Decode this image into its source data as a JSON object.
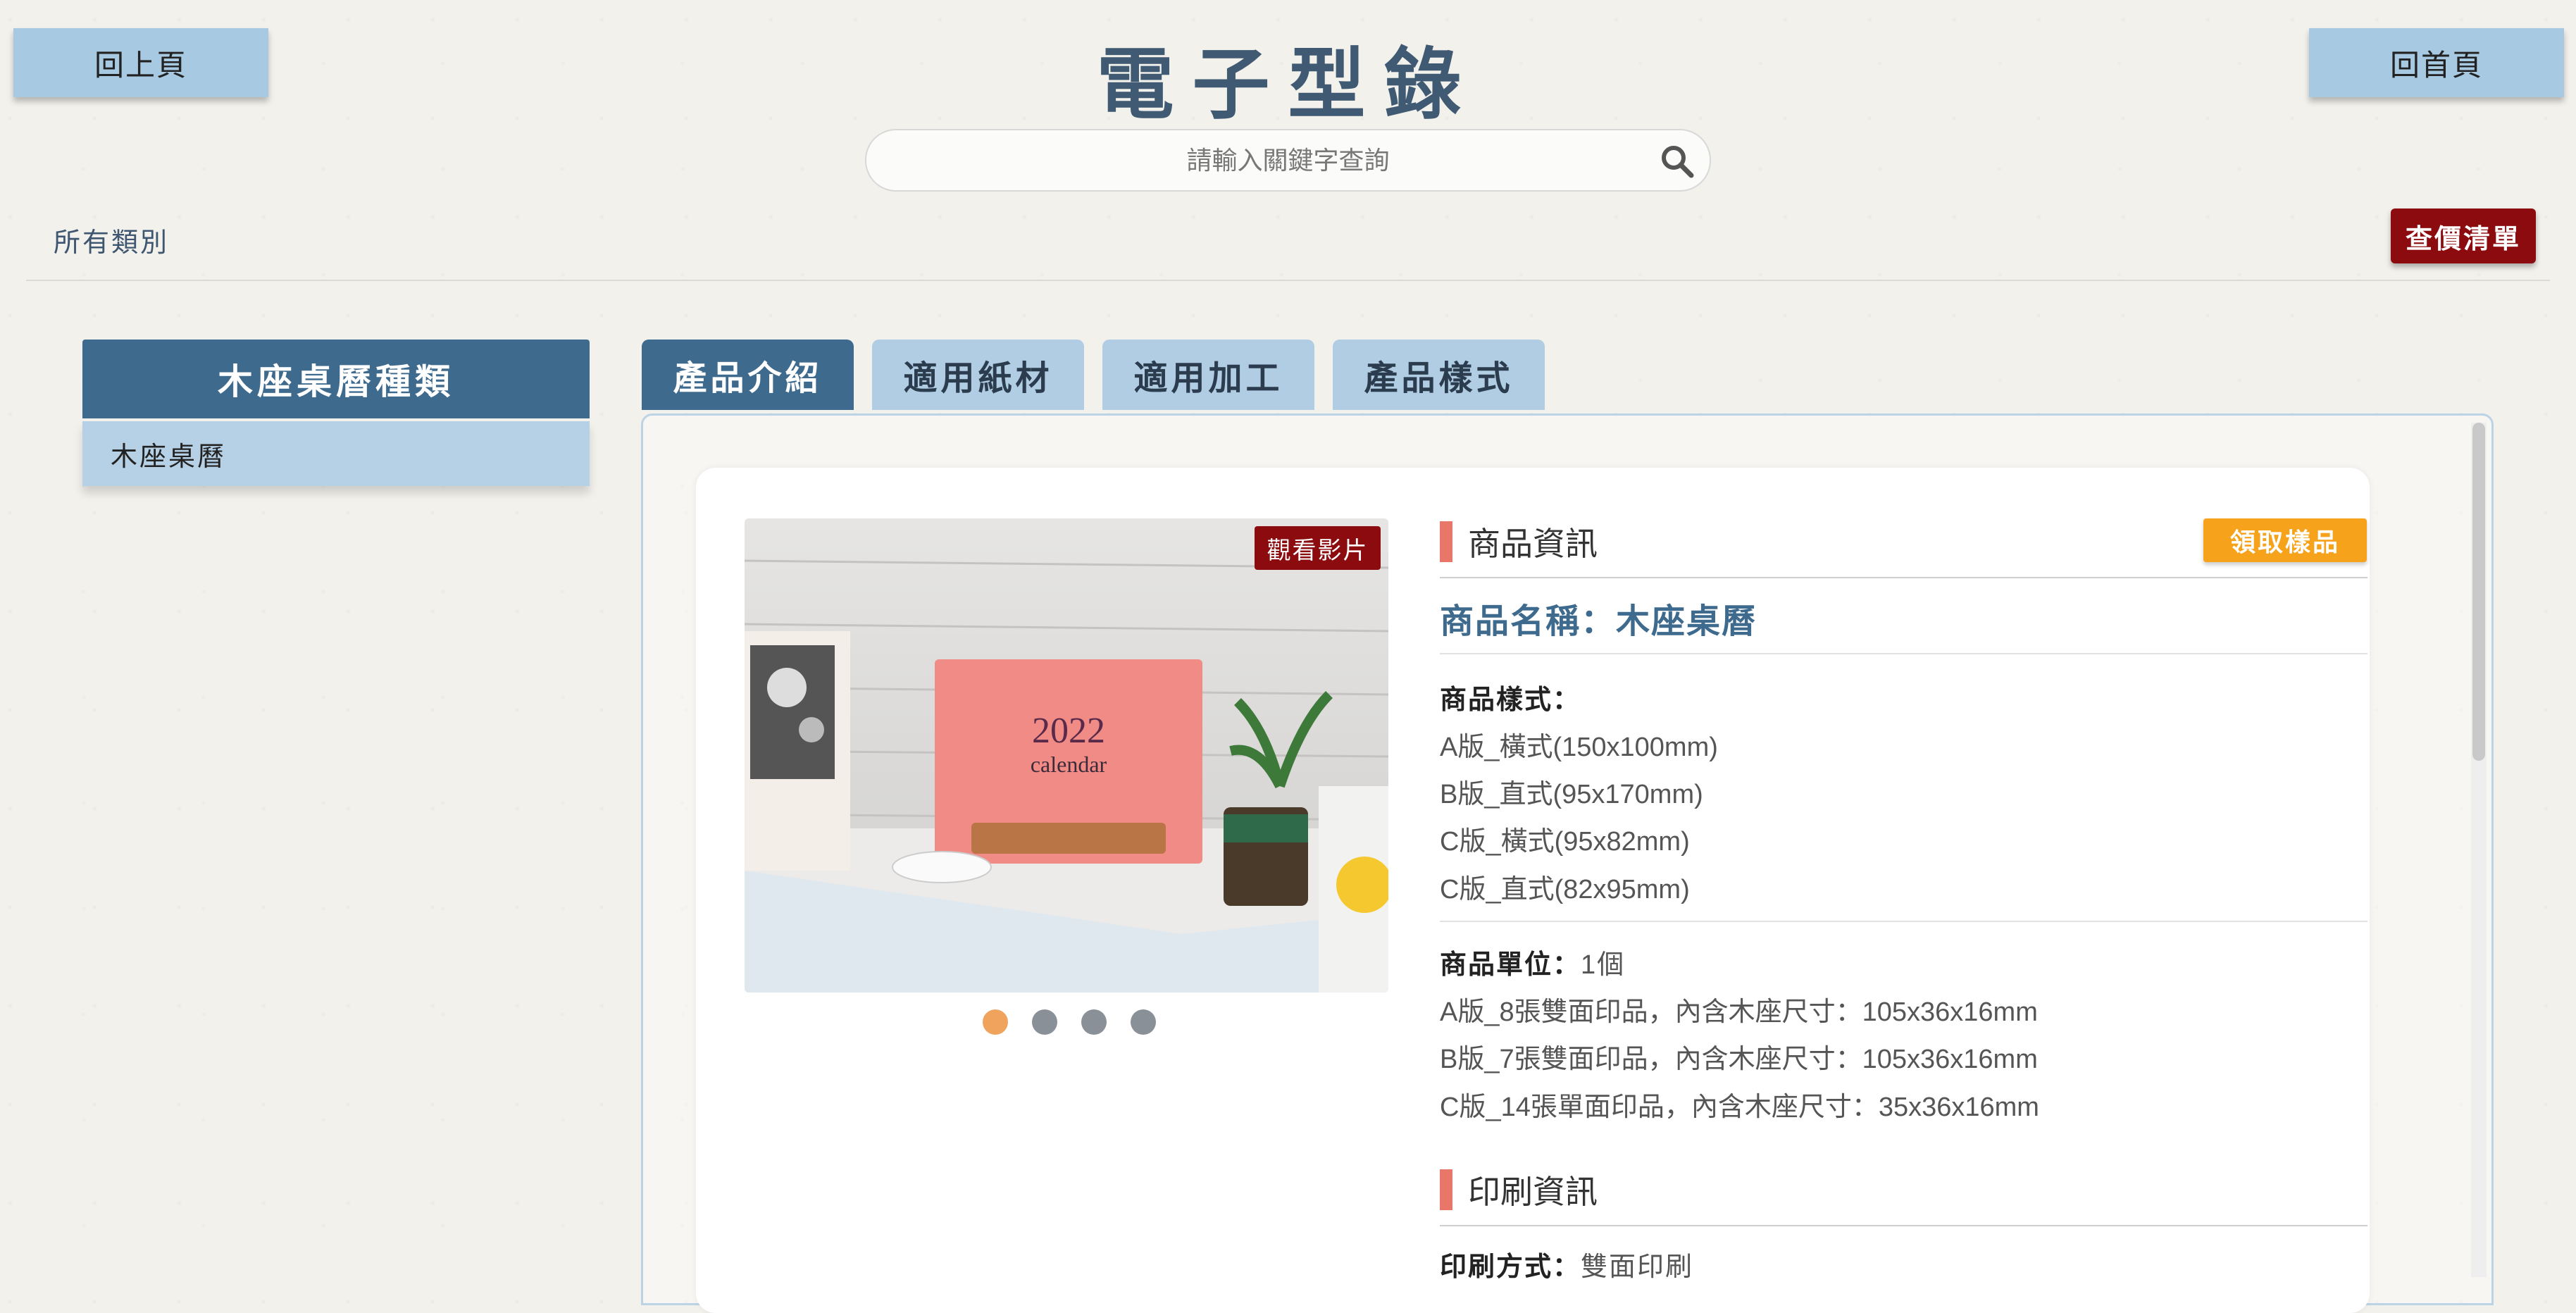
{
  "header": {
    "back_label": "回上頁",
    "title": "電子型錄",
    "home_label": "回首頁",
    "search_placeholder": "請輸入關鍵字查詢"
  },
  "nav": {
    "all_categories": "所有類別",
    "price_list": "查價清單"
  },
  "sidebar": {
    "title": "木座桌曆種類",
    "items": [
      {
        "label": "木座桌曆"
      }
    ]
  },
  "tabs": [
    {
      "label": "產品介紹",
      "active": true
    },
    {
      "label": "適用紙材",
      "active": false
    },
    {
      "label": "適用加工",
      "active": false
    },
    {
      "label": "產品樣式",
      "active": false
    }
  ],
  "gallery": {
    "video_label": "觀看影片",
    "calendar_year": "2022",
    "calendar_word": "calendar",
    "slides": 4,
    "active_slide": 1
  },
  "product_info": {
    "section_title": "商品資訊",
    "sample_label": "領取樣品",
    "name": "商品名稱：木座桌曆",
    "style_label": "商品樣式：",
    "styles": [
      "A版_橫式(150x100mm)",
      "B版_直式(95x170mm)",
      "C版_橫式(95x82mm)",
      "C版_直式(82x95mm)"
    ],
    "unit_label": "商品單位：",
    "unit_value": "1個",
    "unit_details": [
      "A版_8張雙面印品，內含木座尺寸：105x36x16mm",
      "B版_7張雙面印品，內含木座尺寸：105x36x16mm",
      "C版_14張單面印品，內含木座尺寸：35x36x16mm"
    ]
  },
  "print_info": {
    "section_title": "印刷資訊",
    "method_label": "印刷方式：",
    "method_value": "雙面印刷"
  },
  "colors": {
    "primary": "#3e6a8e",
    "tab_inactive": "#b1cde3",
    "danger": "#8b0b0f",
    "sample": "#f6a21b",
    "section_bar": "#e8776a",
    "dot_active": "#f0a35c"
  }
}
